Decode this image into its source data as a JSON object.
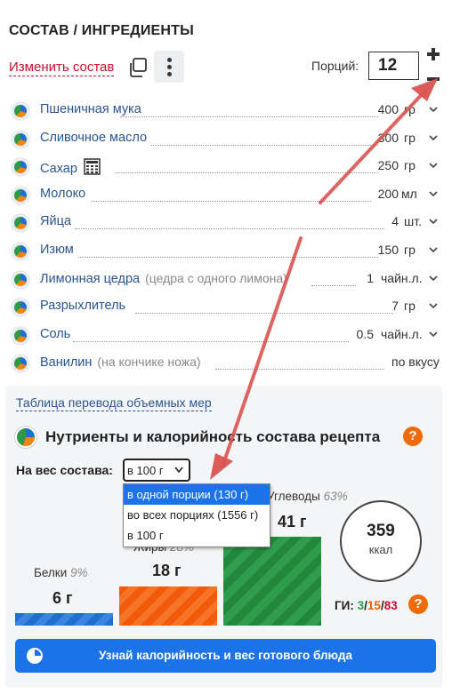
{
  "section_title": "СОСТАВ / ИНГРЕДИЕНТЫ",
  "toolbar": {
    "edit_label": "Изменить состав",
    "copy_icon": "copy-icon",
    "more_icon": "more-vertical-icon",
    "portions_label": "Порций:",
    "portions_value": "12"
  },
  "ingredients": [
    {
      "name": "Пшеничная мука",
      "note": "",
      "qty": "400",
      "unit": "гр"
    },
    {
      "name": "Сливочное масло",
      "note": "",
      "qty": "300",
      "unit": "гр"
    },
    {
      "name": "Сахар",
      "note": "",
      "qty": "250",
      "unit": "гр"
    },
    {
      "name": "Молоко",
      "note": "",
      "qty": "200",
      "unit": "мл"
    },
    {
      "name": "Яйца",
      "note": "",
      "qty": "4",
      "unit": "шт."
    },
    {
      "name": "Изюм",
      "note": "",
      "qty": "150",
      "unit": "гр"
    },
    {
      "name": "Лимонная цедра",
      "note": "(цедра с одного лимона)",
      "qty": "1",
      "unit": "чайн.л."
    },
    {
      "name": "Разрыхлитель",
      "note": "",
      "qty": "7",
      "unit": "гр"
    },
    {
      "name": "Соль",
      "note": "",
      "qty": "0.5",
      "unit": "чайн.л."
    },
    {
      "name": "Ванилин",
      "note": "(на кончике ножа)",
      "qty": "",
      "unit": "по вкусу"
    }
  ],
  "nutrients": {
    "conversion_link": "Таблица перевода объемных мер",
    "title": "Нутриенты и калорийность состава рецепта",
    "help": "?",
    "weight_label": "На вес состава:",
    "weight_selected": "в 100 г",
    "weight_options": [
      "в одной порции (130 г)",
      "во всех порциях (1556 г)",
      "в 100 г"
    ],
    "proteins": {
      "label": "Белки",
      "pct": "9%",
      "value": "6 г"
    },
    "fats": {
      "label": "Жиры",
      "pct": "28%",
      "value": "18 г"
    },
    "carbs": {
      "label": "Углеводы",
      "pct": "63%",
      "value": "41 г"
    },
    "kcal_value": "359",
    "kcal_unit": "ккал",
    "gi_label": "ГИ:",
    "gi_low": "3",
    "gi_mid": "15",
    "gi_high": "83"
  },
  "cta_label": "Узнай калорийность и вес готового блюда",
  "colors": {
    "accent": "#1a73e8",
    "link": "#2a5592",
    "edit": "#c8102e",
    "protein": "#1f6fd1",
    "fat": "#f05a0a",
    "carb": "#23883e",
    "arrow": "#d9534f"
  }
}
